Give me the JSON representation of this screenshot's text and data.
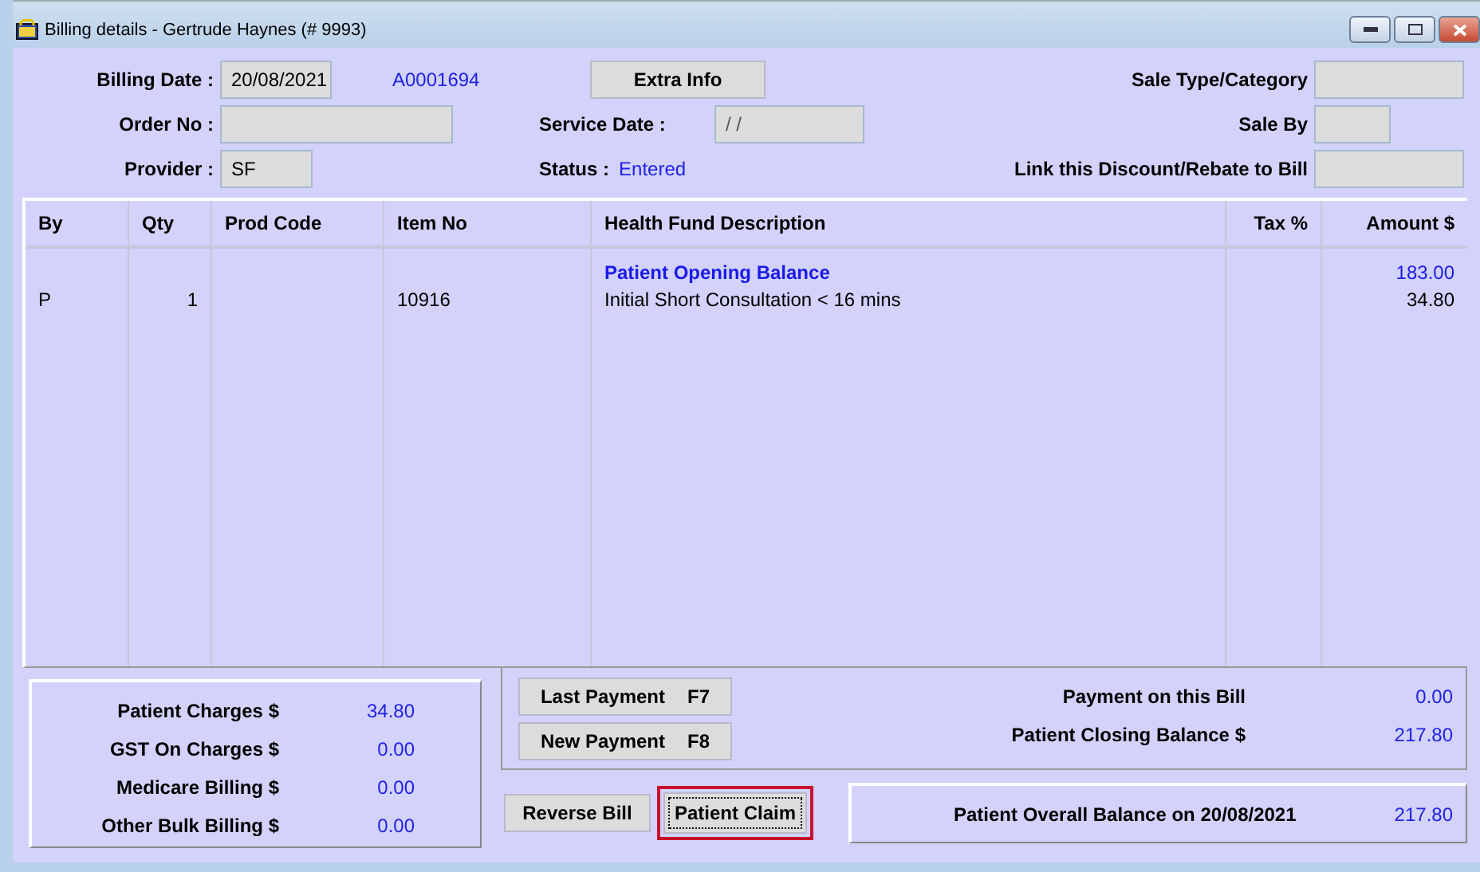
{
  "window": {
    "title": "Billing details - Gertrude Haynes  (# 9993)"
  },
  "header": {
    "billing_date": {
      "label": "Billing Date :",
      "value": "20/08/2021"
    },
    "reference": "A0001694",
    "extra_info_button": "Extra Info",
    "order_no": {
      "label": "Order No :"
    },
    "service_date": {
      "label": "Service Date :",
      "value": "/  /"
    },
    "provider": {
      "label": "Provider :",
      "value": "SF"
    },
    "status": {
      "label": "Status :",
      "value": "Entered"
    },
    "sale_type": {
      "label": "Sale Type/Category"
    },
    "sale_by": {
      "label": "Sale By"
    },
    "link_discount": {
      "label": "Link this Discount/Rebate to Bill"
    }
  },
  "table": {
    "columns": [
      "By",
      "Qty",
      "Prod Code",
      "Item No",
      "Health Fund Description",
      "Tax %",
      "Amount $"
    ],
    "rows": [
      {
        "kind": "balance",
        "description": "Patient Opening Balance",
        "amount": "183.00"
      },
      {
        "kind": "item",
        "by": "P",
        "qty": "1",
        "item_no": "10916",
        "description": "Initial Short Consultation < 16 mins",
        "amount": "34.80"
      }
    ]
  },
  "totals": [
    {
      "label": "Patient Charges $",
      "value": "34.80"
    },
    {
      "label": "GST On Charges $",
      "value": "0.00"
    },
    {
      "label": "Medicare Billing $",
      "value": "0.00"
    },
    {
      "label": "Other Bulk Billing $",
      "value": "0.00"
    }
  ],
  "payment_buttons": [
    {
      "label": "Last Payment",
      "key": "F7"
    },
    {
      "label": "New Payment",
      "key": "F8"
    }
  ],
  "payment_summary": [
    {
      "label": "Payment on this Bill",
      "value": "0.00"
    },
    {
      "label": "Patient Closing Balance $",
      "value": "217.80"
    }
  ],
  "action_buttons": [
    {
      "label": "Reverse Bill",
      "focused": false,
      "highlighted": false
    },
    {
      "label": "Patient Claim",
      "focused": true,
      "highlighted": true
    }
  ],
  "overall_balance": {
    "label": "Patient Overall Balance on 20/08/2021",
    "value": "217.80"
  }
}
